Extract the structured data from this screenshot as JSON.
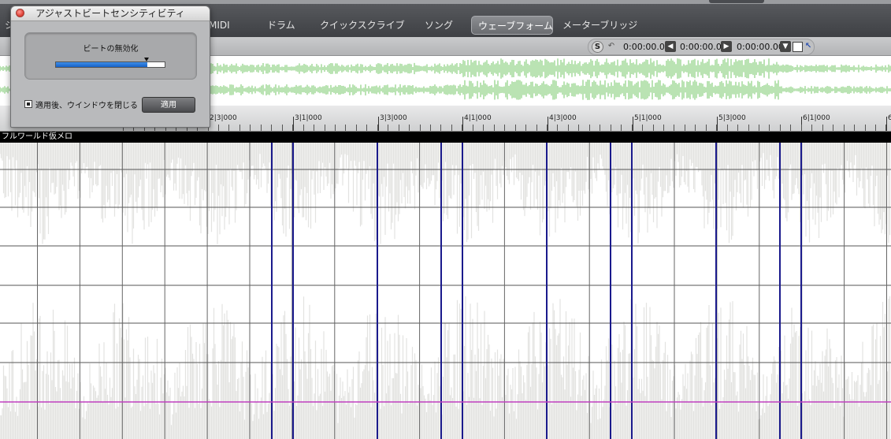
{
  "tabs": [
    {
      "label": "シ",
      "active": false
    },
    {
      "label": "MIDI",
      "active": false
    },
    {
      "label": "ドラム",
      "active": false
    },
    {
      "label": "クイックスクライブ",
      "active": false
    },
    {
      "label": "ソング",
      "active": false
    },
    {
      "label": "ウェーブフォーム",
      "active": true
    },
    {
      "label": "メーターブリッジ",
      "active": false
    }
  ],
  "transport": {
    "s_label": "S",
    "time1": "0:00:00.00",
    "time2": "0:00:00.00",
    "time3": "0:00:00.00",
    "icons": [
      "undo-icon",
      "left-arrow-icon",
      "right-arrow-icon",
      "dropdown-icon",
      "stop-icon",
      "loop-icon"
    ]
  },
  "ruler": {
    "labels": [
      "2|3|000",
      "3|1|000",
      "3|3|000",
      "4|1|000",
      "4|3|000",
      "5|1|000",
      "5|3|000",
      "6|1|000",
      "6"
    ]
  },
  "track": {
    "name": "フルワールド仮メロ"
  },
  "dialog": {
    "title": "アジャストビートセンシティビティ",
    "panel_label": "ビートの無効化",
    "slider_value": 0.84,
    "checkbox_label": "適用後、ウインドウを閉じる",
    "checkbox_checked": true,
    "apply_label": "適用"
  },
  "colors": {
    "overview_wave": "#a8dca0",
    "main_wave": "#e3e3e1",
    "beat_marker": "#1a1a8c",
    "playhead": "#c040c0",
    "grid": "#444444",
    "slider_fill": "#1f6fd6"
  }
}
